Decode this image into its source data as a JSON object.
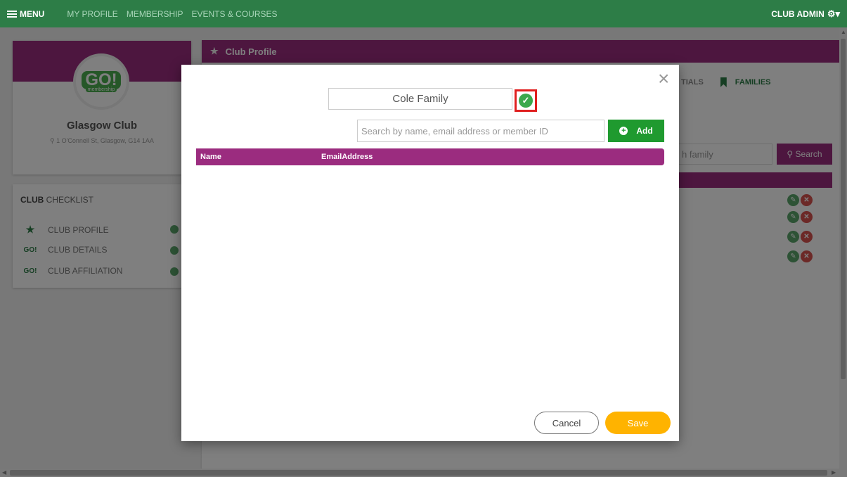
{
  "topnav": {
    "menu_label": "MENU",
    "links": [
      "MY PROFILE",
      "MEMBERSHIP",
      "EVENTS & COURSES"
    ],
    "admin_label": "CLUB ADMIN"
  },
  "club": {
    "logo_text": "GO!",
    "logo_sub": "membership",
    "name": "Glasgow Club",
    "address": "1 O'Connell St, Glasgow, G14 1AA"
  },
  "checklist": {
    "title_bold": "CLUB",
    "title_rest": " CHECKLIST",
    "items": [
      {
        "icon": "★",
        "label": "CLUB PROFILE"
      },
      {
        "icon": "GO!",
        "label": "CLUB DETAILS"
      },
      {
        "icon": "GO!",
        "label": "CLUB AFFILIATION"
      }
    ]
  },
  "panel": {
    "title": "Club Profile",
    "tab_partial": "TIALS",
    "tab_families": "FAMILIES",
    "search_partial": "h family",
    "search_btn": "Search"
  },
  "modal": {
    "family_name": "Cole Family",
    "search_placeholder": "Search by name, email address or member ID",
    "add_label": "Add",
    "columns": [
      "Name",
      "EmailAddress"
    ],
    "cancel_label": "Cancel",
    "save_label": "Save"
  },
  "colors": {
    "nav_green": "#2d7d47",
    "brand_purple": "#9b2c7f",
    "add_green": "#1f9a2f",
    "save_amber": "#ffb300",
    "highlight_red": "#e02020"
  }
}
